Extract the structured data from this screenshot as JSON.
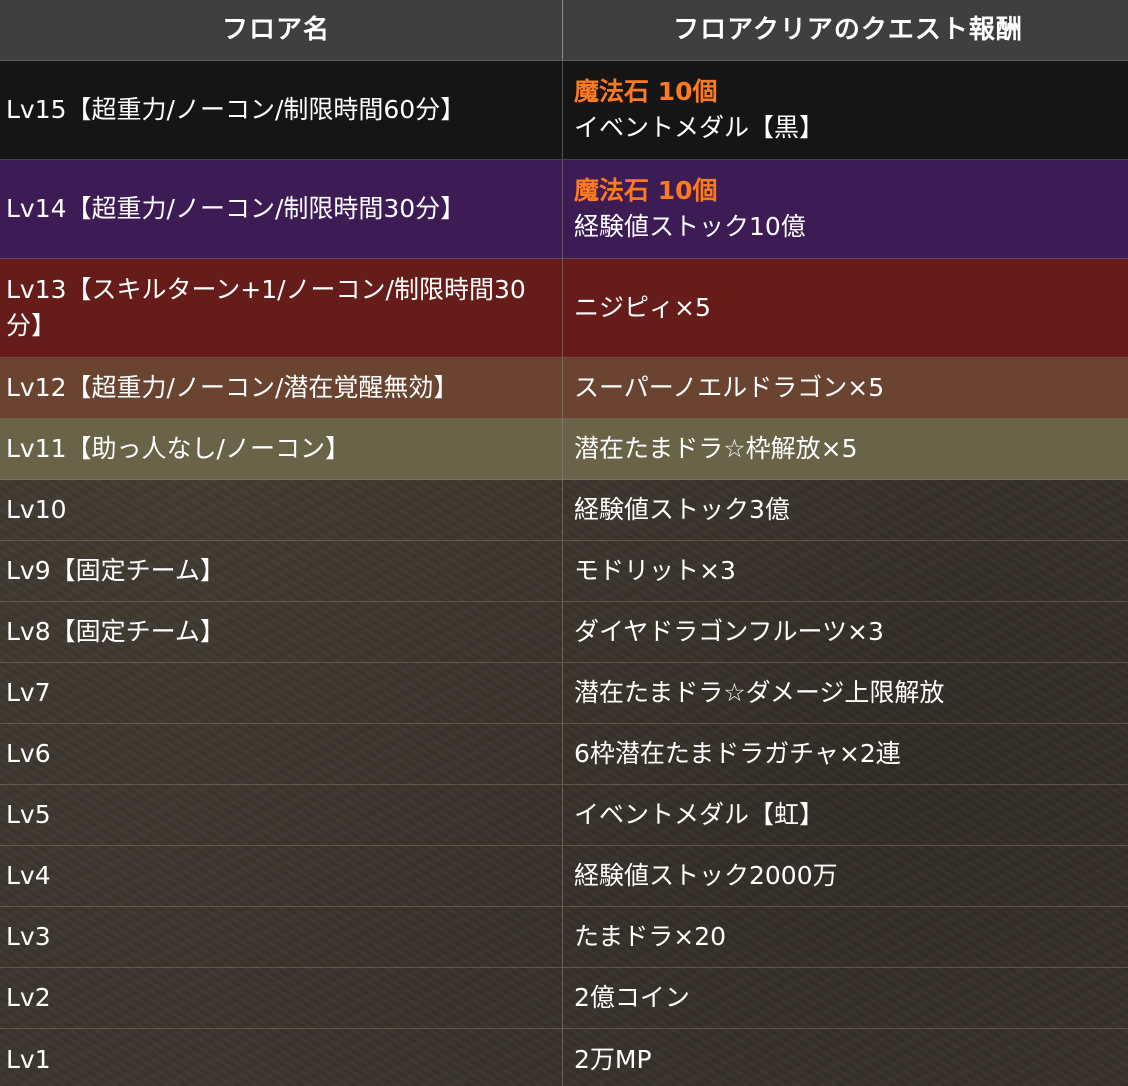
{
  "header": {
    "col1": "フロア名",
    "col2": "フロアクリアのクエスト報酬"
  },
  "rows": [
    {
      "floor": "Lv15【超重力/ノーコン/制限時間60分】",
      "reward_accent": "魔法石 10個",
      "reward": "イベントメダル【黒】"
    },
    {
      "floor": "Lv14【超重力/ノーコン/制限時間30分】",
      "reward_accent": "魔法石 10個",
      "reward": "経験値ストック10億"
    },
    {
      "floor": "Lv13【スキルターン+1/ノーコン/制限時間30分】",
      "reward": "ニジピィ×5"
    },
    {
      "floor": "Lv12【超重力/ノーコン/潜在覚醒無効】",
      "reward": "スーパーノエルドラゴン×5"
    },
    {
      "floor": "Lv11【助っ人なし/ノーコン】",
      "reward": "潜在たまドラ☆枠解放×5"
    },
    {
      "floor": "Lv10",
      "reward": "経験値ストック3億"
    },
    {
      "floor": "Lv9【固定チーム】",
      "reward": "モドリット×3"
    },
    {
      "floor": "Lv8【固定チーム】",
      "reward": "ダイヤドラゴンフルーツ×3"
    },
    {
      "floor": "Lv7",
      "reward": "潜在たまドラ☆ダメージ上限解放"
    },
    {
      "floor": "Lv6",
      "reward": "6枠潜在たまドラガチャ×2連"
    },
    {
      "floor": "Lv5",
      "reward": "イベントメダル【虹】"
    },
    {
      "floor": "Lv4",
      "reward": "経験値ストック2000万"
    },
    {
      "floor": "Lv3",
      "reward": "たまドラ×20"
    },
    {
      "floor": "Lv2",
      "reward": "2億コイン"
    },
    {
      "floor": "Lv1",
      "reward": "2万MP"
    }
  ],
  "colors": {
    "header_bg": "#3f3f3f",
    "accent": "#ff7a1f",
    "lv15_bg": "#151515",
    "lv14_bg": "#3d1b55",
    "lv13_bg": "#661d1a",
    "lv12_bg": "#6a4431",
    "lv11_bg": "#6a6347",
    "default_bg": "#3a352d"
  }
}
